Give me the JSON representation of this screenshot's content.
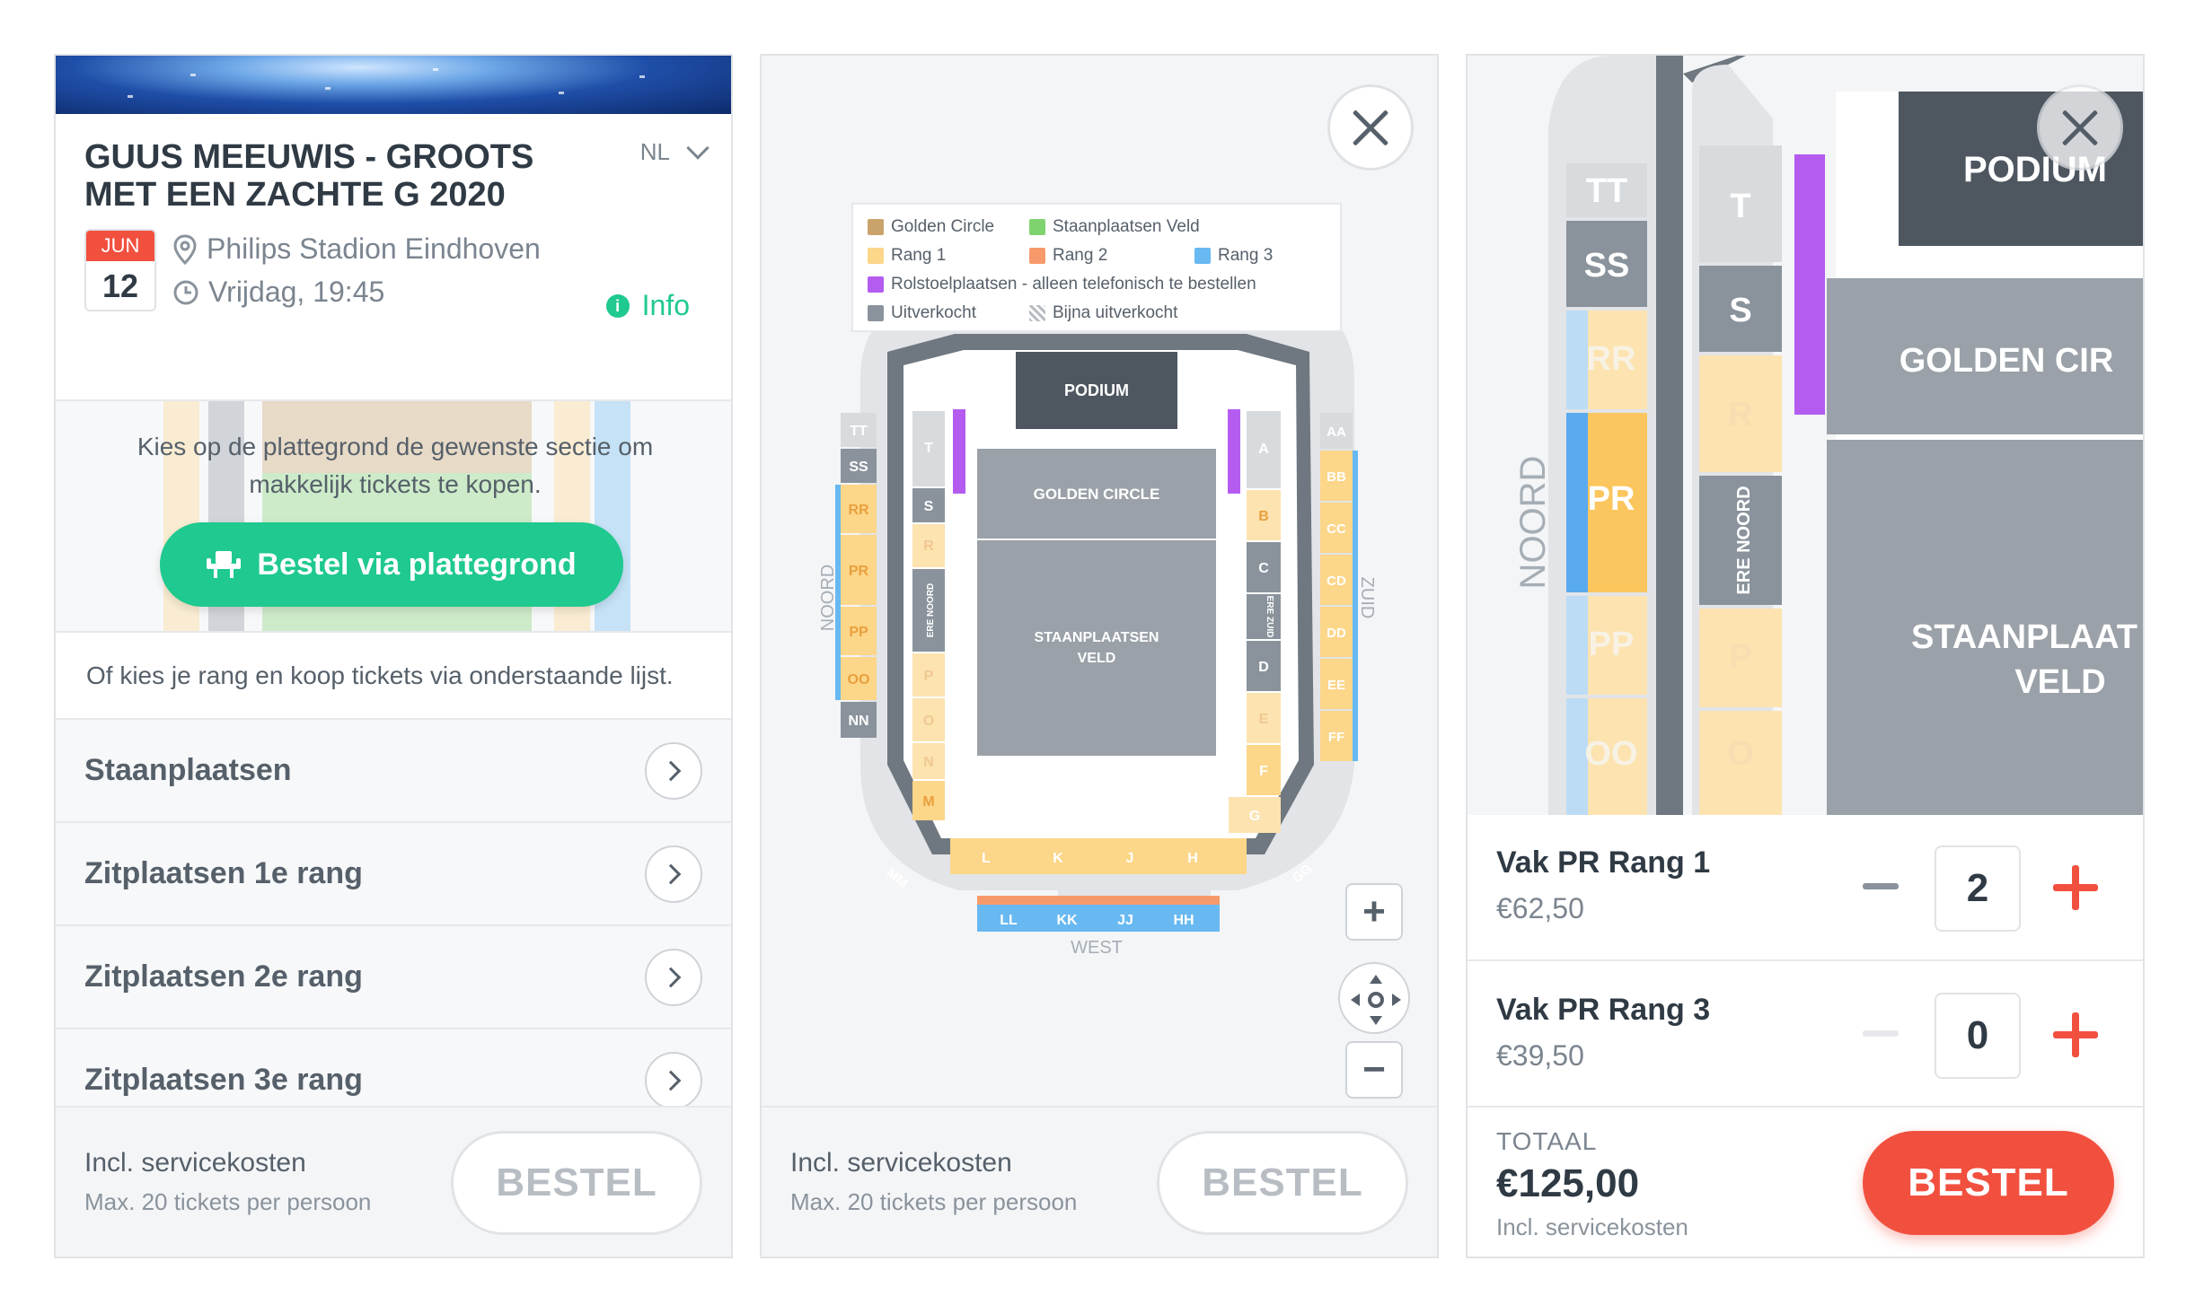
{
  "colors": {
    "golden_circle": "#c9a36a",
    "staanplaatsen_veld": "#7fd36f",
    "rang1": "#fcd689",
    "rang2": "#f79a6b",
    "rang3": "#68b9f2",
    "rolstoel": "#b45cf0",
    "uitverkocht": "#8a939c",
    "accent_green": "#1fc98f",
    "accent_red": "#f2503f"
  },
  "panel1": {
    "event_title": "GUUS MEEUWIS - GROOTS MET EEN ZACHTE G 2020",
    "language": "NL",
    "date_month": "JUN",
    "date_day": "12",
    "venue": "Philips Stadion Eindhoven",
    "datetime": "Vrijdag, 19:45",
    "info_label": "Info",
    "map_prompt": "Kies op de plattegrond de gewenste sectie om makkelijk tickets te kopen.",
    "map_button": "Bestel via plattegrond",
    "list_intro": "Of kies je rang en koop tickets via onderstaande lijst.",
    "categories": [
      "Staanplaatsen",
      "Zitplaatsen 1e rang",
      "Zitplaatsen 2e rang",
      "Zitplaatsen 3e rang"
    ]
  },
  "footer": {
    "fee_label": "Incl. servicekosten",
    "max_label": "Max. 20 tickets per persoon",
    "order_button": "BESTEL"
  },
  "panel2": {
    "legend": {
      "golden_circle": "Golden Circle",
      "staanplaatsen_veld": "Staanplaatsen Veld",
      "rang1": "Rang 1",
      "rang2": "Rang 2",
      "rang3": "Rang 3",
      "rolstoel": "Rolstoelplaatsen - alleen telefonisch te bestellen",
      "uitverkocht": "Uitverkocht",
      "bijna": "Bijna uitverkocht"
    },
    "map": {
      "podium": "PODIUM",
      "golden_circle": "GOLDEN CIRCLE",
      "veld_line1": "STAANPLAATSEN",
      "veld_line2": "VELD",
      "noord": "NOORD",
      "zuid": "ZUID",
      "west": "WEST",
      "ere_noord": "ERE NOORD",
      "ere_zuid": "ERE ZUID",
      "north_outer": [
        "TT",
        "SS",
        "RR",
        "PR",
        "PP",
        "OO",
        "NN"
      ],
      "north_inner": [
        "T",
        "S",
        "R",
        "P",
        "O",
        "N",
        "M"
      ],
      "south_outer": [
        "AA",
        "BB",
        "CC",
        "CD",
        "DD",
        "EE",
        "FF"
      ],
      "south_inner": [
        "A",
        "B",
        "C",
        "D",
        "E",
        "F",
        "G"
      ],
      "west_inner": [
        "L",
        "K",
        "J",
        "H"
      ],
      "west_outer": [
        "LL",
        "KK",
        "JJ",
        "HH"
      ],
      "corners": [
        "MM",
        "GG"
      ]
    },
    "zoom_in": "+",
    "zoom_out": "−"
  },
  "panel3": {
    "map": {
      "podium": "PODIUM",
      "golden_circle": "GOLDEN CIR",
      "veld_line1": "STAANPLAAT",
      "veld_line2": "VELD",
      "noord": "NOORD",
      "ere_noord": "ERE NOORD",
      "outer": [
        "TT",
        "SS",
        "RR",
        "PR",
        "PP",
        "OO"
      ],
      "inner": [
        "T",
        "S",
        "R",
        "P",
        "O"
      ]
    },
    "tickets": [
      {
        "name": "Vak PR Rang 1",
        "price": "€62,50",
        "qty": "2"
      },
      {
        "name": "Vak PR Rang 3",
        "price": "€39,50",
        "qty": "0"
      }
    ],
    "total_label": "TOTAAL",
    "total_value": "€125,00",
    "total_sub": "Incl. servicekosten",
    "order_button": "BESTEL"
  }
}
